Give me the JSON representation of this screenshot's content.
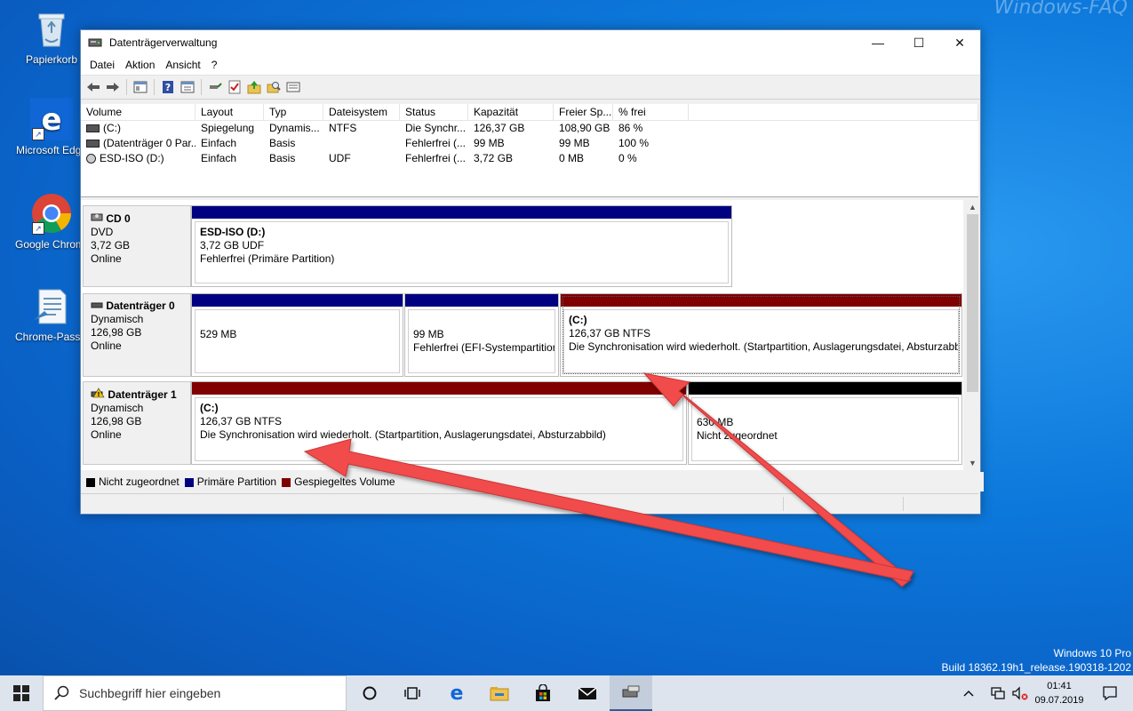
{
  "watermark": "Windows-FAQ",
  "desktop": {
    "icons": [
      {
        "label": "Papierkorb"
      },
      {
        "label": "Microsoft Edge"
      },
      {
        "label": "Google Chrome"
      },
      {
        "label": "Chrome-Passwort"
      }
    ],
    "os_name": "Windows 10 Pro",
    "build": "Build 18362.19h1_release.190318-1202"
  },
  "window": {
    "title": "Datenträgerverwaltung",
    "minimize": "—",
    "maximize": "☐",
    "close": "✕",
    "menu": [
      "Datei",
      "Aktion",
      "Ansicht",
      "?"
    ],
    "toolbar_icons": [
      "back-arrow-icon",
      "forward-arrow-icon",
      "console-tree-icon",
      "help-icon",
      "properties-icon",
      "connect-icon",
      "check-icon",
      "folder-up-icon",
      "search-folder-icon",
      "list-icon"
    ]
  },
  "volume_list": {
    "columns": [
      "Volume",
      "Layout",
      "Typ",
      "Dateisystem",
      "Status",
      "Kapazität",
      "Freier Sp...",
      "% frei",
      ""
    ],
    "rows": [
      {
        "volume": "(C:)",
        "layout": "Spiegelung",
        "typ": "Dynamis...",
        "fs": "NTFS",
        "status": "Die Synchr...",
        "kap": "126,37 GB",
        "frei": "108,90 GB",
        "pct": "86 %"
      },
      {
        "volume": "(Datenträger 0 Par...",
        "layout": "Einfach",
        "typ": "Basis",
        "fs": "",
        "status": "Fehlerfrei (...",
        "kap": "99 MB",
        "frei": "99 MB",
        "pct": "100 %"
      },
      {
        "volume": "ESD-ISO (D:)",
        "layout": "Einfach",
        "typ": "Basis",
        "fs": "UDF",
        "status": "Fehlerfrei (...",
        "kap": "3,72 GB",
        "frei": "0 MB",
        "pct": "0 %"
      }
    ]
  },
  "disks": [
    {
      "name": "CD 0",
      "type": "DVD",
      "size": "3,72 GB",
      "state": "Online",
      "partitions": [
        {
          "name": "ESD-ISO  (D:)",
          "line1": "3,72 GB UDF",
          "line2": "Fehlerfrei (Primäre Partition)",
          "color": "#000080"
        }
      ]
    },
    {
      "name": "Datenträger 0",
      "type": "Dynamisch",
      "size": "126,98 GB",
      "state": "Online",
      "partitions": [
        {
          "name": "",
          "line1": "529 MB",
          "line2": "",
          "color": "#000080"
        },
        {
          "name": "",
          "line1": "99 MB",
          "line2": "Fehlerfrei (EFI-Systempartition",
          "color": "#000080"
        },
        {
          "name": "(C:)",
          "line1": "126,37 GB NTFS",
          "line2": "Die Synchronisation wird wiederholt. (Startpartition, Auslagerungsdatei, Absturzabb",
          "color": "#800000"
        }
      ]
    },
    {
      "name": "Datenträger 1",
      "type": "Dynamisch",
      "size": "126,98 GB",
      "state": "Online",
      "partitions": [
        {
          "name": "(C:)",
          "line1": "126,37 GB NTFS",
          "line2": "Die Synchronisation wird wiederholt. (Startpartition, Auslagerungsdatei, Absturzabbild)",
          "color": "#800000"
        },
        {
          "name": "",
          "line1": "630 MB",
          "line2": "Nicht zugeordnet",
          "color": "#000000"
        }
      ]
    }
  ],
  "legend": [
    {
      "label": "Nicht zugeordnet",
      "color": "#000000"
    },
    {
      "label": "Primäre Partition",
      "color": "#000080"
    },
    {
      "label": "Gespiegeltes Volume",
      "color": "#800000"
    }
  ],
  "taskbar": {
    "search_placeholder": "Suchbegriff hier eingeben",
    "time": "01:41",
    "date": "09.07.2019"
  },
  "accent": {
    "arrow": "#f24b4b",
    "taskbar": "#dde4ee",
    "window_border": "#5e85b6"
  }
}
